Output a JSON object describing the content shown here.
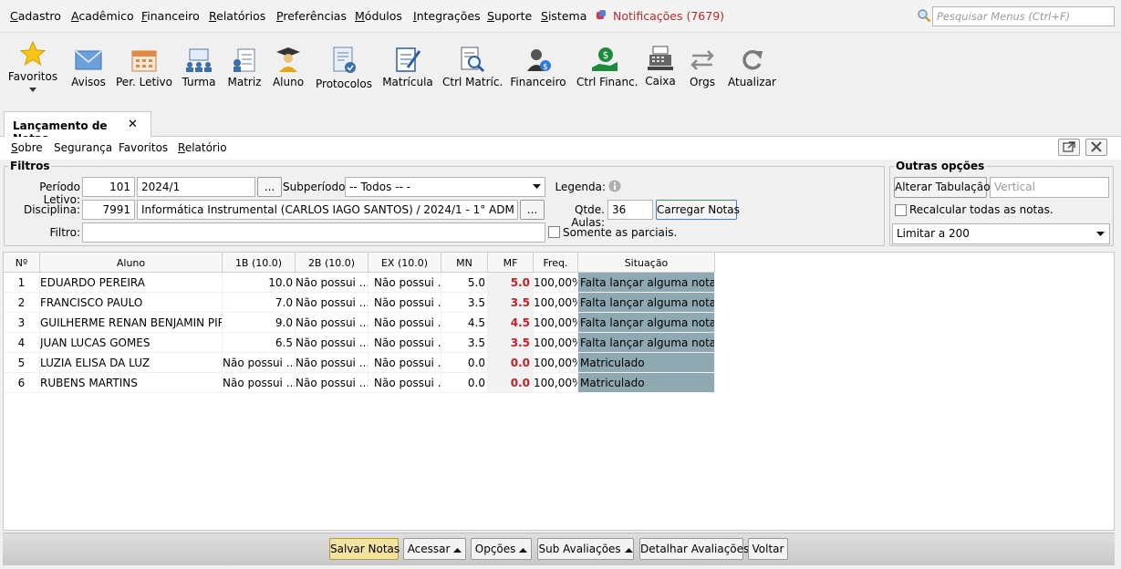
{
  "menu": {
    "items": [
      "Cadastro",
      "Acadêmico",
      "Financeiro",
      "Relatórios",
      "Preferências",
      "Módulos",
      "Integrações",
      "Suporte",
      "Sistema"
    ],
    "notifications": "Notificações (7679)",
    "search_placeholder": "Pesquisar Menus (Ctrl+F)"
  },
  "toolbar": {
    "favoritos": "Favoritos",
    "avisos": "Avisos",
    "per_letivo": "Per. Letivo",
    "turma": "Turma",
    "matriz": "Matriz",
    "aluno": "Aluno",
    "protocolos": "Protocolos",
    "matricula": "Matrícula",
    "ctrl_matric": "Ctrl Matríc.",
    "financeiro": "Financeiro",
    "ctrl_financ": "Ctrl Financ.",
    "caixa": "Caixa",
    "orgs": "Orgs",
    "atualizar": "Atualizar"
  },
  "tab": {
    "title": "Lançamento de Notas",
    "close": "✕"
  },
  "submenu": [
    "Sobre",
    "Segurança",
    "Favoritos",
    "Relatório"
  ],
  "filtros": {
    "legend": "Filtros",
    "periodo_label": "Período Letivo:",
    "periodo_code": "101",
    "periodo_value": "2024/1",
    "ellipsis": "...",
    "subperiodo_label": "Subperíodo:",
    "subperiodo_value": "-- Todos -- -",
    "legenda_label": "Legenda:",
    "disciplina_label": "Disciplina:",
    "disciplina_code": "7991",
    "disciplina_value": "Informática Instrumental (CARLOS IAGO SANTOS) / 2024/1 - 1° ADM",
    "qtde_label": "Qtde. Aulas:",
    "qtde_value": "36",
    "carregar": "Carregar Notas",
    "filtro_label": "Filtro:",
    "filtro_value": "",
    "somente": "Somente as parciais."
  },
  "outras": {
    "legend": "Outras opções",
    "alterar": "Alterar Tabulação",
    "vertical_placeholder": "Vertical",
    "recalcular": "Recalcular todas as notas.",
    "limitar": "Limitar a 200"
  },
  "grid": {
    "headers": [
      "Nº",
      "Aluno",
      "1B (10.0)",
      "2B (10.0)",
      "EX (10.0)",
      "MN",
      "MF",
      "Freq.",
      "Situação"
    ],
    "rows": [
      [
        "1",
        "EDUARDO PEREIRA",
        "10.0",
        "Não possui ...",
        "Não possui ...",
        "5.0",
        "5.0",
        "100,00%",
        "Falta lançar alguma nota"
      ],
      [
        "2",
        "FRANCISCO PAULO",
        "7.0",
        "Não possui ...",
        "Não possui ...",
        "3.5",
        "3.5",
        "100,00%",
        "Falta lançar alguma nota"
      ],
      [
        "3",
        "GUILHERME RENAN BENJAMIN PIR...",
        "9.0",
        "Não possui ...",
        "Não possui ...",
        "4.5",
        "4.5",
        "100,00%",
        "Falta lançar alguma nota"
      ],
      [
        "4",
        "JUAN LUCAS GOMES",
        "6.5",
        "Não possui ...",
        "Não possui ...",
        "3.5",
        "3.5",
        "100,00%",
        "Falta lançar alguma nota"
      ],
      [
        "5",
        "LUZIA ELISA DA LUZ",
        "Não possui ...",
        "Não possui ...",
        "Não possui ...",
        "0.0",
        "0.0",
        "100,00%",
        "Matriculado"
      ],
      [
        "6",
        "RUBENS MARTINS",
        "Não possui ...",
        "Não possui ...",
        "Não possui ...",
        "0.0",
        "0.0",
        "100,00%",
        "Matriculado"
      ]
    ]
  },
  "bottom": {
    "salvar": "Salvar Notas",
    "acessar": "Acessar",
    "opcoes": "Opções",
    "sub": "Sub Avaliações",
    "detalhar": "Detalhar Avaliações",
    "voltar": "Voltar"
  },
  "colors": {
    "accent_red": "#c0202a",
    "situacao_bg": "#8fa9b2",
    "salvar_bg": "#f3e3a3"
  }
}
